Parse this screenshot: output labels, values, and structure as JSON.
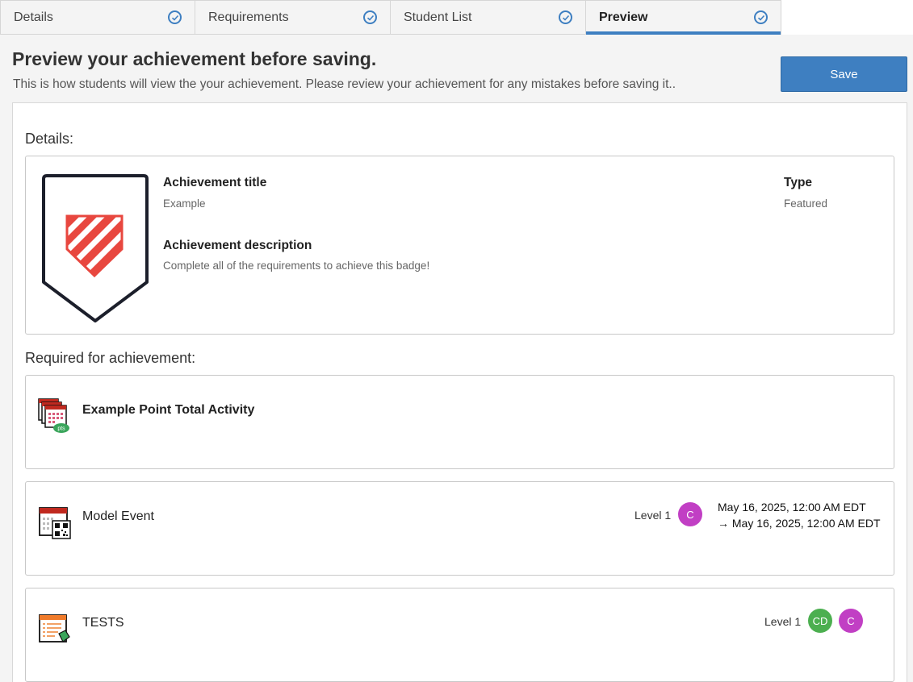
{
  "tabs": [
    {
      "label": "Details",
      "checked": true
    },
    {
      "label": "Requirements",
      "checked": true
    },
    {
      "label": "Student List",
      "checked": true
    },
    {
      "label": "Preview",
      "checked": true,
      "active": true
    }
  ],
  "header": {
    "title": "Preview your achievement before saving.",
    "subtitle": "This is how students will view the your achievement. Please review your achievement for any mistakes before saving it..",
    "save_label": "Save"
  },
  "details": {
    "section_label": "Details:",
    "title_label": "Achievement title",
    "title_value": "Example",
    "description_label": "Achievement description",
    "description_value": "Complete all of the requirements to achieve this badge!",
    "type_label": "Type",
    "type_value": "Featured",
    "badge_icon": "shield-badge-icon"
  },
  "requirements": {
    "section_label": "Required for achievement:",
    "items": [
      {
        "title": "Example Point Total Activity",
        "icon": "point-total-activity-icon",
        "icon_badge_text": "pts"
      },
      {
        "title": "Model Event",
        "icon": "event-qr-icon",
        "level": "Level 1",
        "avatars": [
          {
            "initials": "C",
            "color": "#c13fc4"
          }
        ],
        "date_start": "May 16, 2025, 12:00 AM EDT",
        "date_end": "May 16, 2025, 12:00 AM EDT"
      },
      {
        "title": "TESTS",
        "icon": "test-form-icon",
        "level": "Level 1",
        "avatars": [
          {
            "initials": "CD",
            "color": "#4caf50"
          },
          {
            "initials": "C",
            "color": "#c13fc4"
          }
        ]
      }
    ]
  },
  "colors": {
    "accent": "#3e7fc1",
    "badge_red": "#e8473f",
    "avatar_purple": "#c13fc4",
    "avatar_green": "#4caf50"
  }
}
